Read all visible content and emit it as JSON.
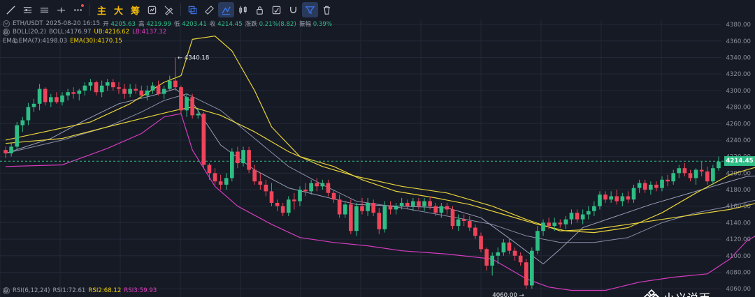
{
  "toolbar": {
    "items": [
      {
        "name": "trend-line-icon"
      },
      {
        "name": "horizontal-lines-icon"
      },
      {
        "name": "parallel-lines-icon"
      },
      {
        "name": "ray-line-icon"
      },
      {
        "name": "more-icon"
      },
      {
        "name": "cjk-main",
        "text": "主"
      },
      {
        "name": "cjk-big",
        "text": "大"
      },
      {
        "name": "cjk-chip",
        "text": "筹"
      },
      {
        "name": "indicator-icon"
      },
      {
        "name": "draw-off-icon"
      },
      {
        "name": "copy-icon"
      },
      {
        "name": "ruler-icon"
      },
      {
        "name": "draw-active-icon"
      },
      {
        "name": "candle-type-icon"
      },
      {
        "name": "lock-icon"
      },
      {
        "name": "screenshot-icon"
      },
      {
        "name": "magnet-icon"
      },
      {
        "name": "filter-icon"
      },
      {
        "name": "trash-icon"
      }
    ]
  },
  "ohlc": {
    "symbol": "ETH/USDT",
    "datetime": "2025-08-20 16:15",
    "open_label": "开",
    "open": "4205.63",
    "high_label": "高",
    "high": "4219.99",
    "low_label": "低",
    "low": "4203.41",
    "close_label": "收",
    "close": "4214.45",
    "change_label": "涨跌",
    "change": "0.21%(8.82)",
    "amp_label": "振幅",
    "amp": "0.39%"
  },
  "boll": {
    "name": "BOLL(20,2)",
    "mid": "BOLL:4176.97",
    "ub": "UB:4216.62",
    "lb": "LB:4137.32"
  },
  "ema": {
    "name": "EMA",
    "ema7": "EMA(7):4198.03",
    "ema30": "EMA(30):4170.15"
  },
  "rsi": {
    "name": "RSI(6,12,24)",
    "rsi1": "RSI1:72.61",
    "rsi2": "RSI2:68.12",
    "rsi3": "RSI3:59.93"
  },
  "annotations": {
    "high": "4340.18",
    "low": "4060.00"
  },
  "price_tag": "4214.45",
  "watermark": "@ 小义说币",
  "colors": {
    "up": "#2ebd85",
    "down": "#f0445a",
    "ub": "#e8d33a",
    "lb": "#d63cc0",
    "mid": "#8a8fa8",
    "ema7": "#9a9fb8",
    "ema30": "#e8d33a",
    "grid": "#232838",
    "axis_text": "#8b8f99"
  },
  "chart_data": {
    "type": "candlestick",
    "yaxis": {
      "ticks": [
        "4380.00",
        "4360.00",
        "4340.00",
        "4320.00",
        "4300.00",
        "4280.00",
        "4260.00",
        "4240.00",
        "4220.00",
        "4200.00",
        "4180.00",
        "4160.00",
        "4140.00",
        "4120.00",
        "4100.00",
        "4080.00",
        "4060.00"
      ],
      "range": [
        4050,
        4386
      ]
    },
    "current_price": 4214.45,
    "candles": [
      [
        4228,
        4232,
        4218,
        4224
      ],
      [
        4224,
        4236,
        4220,
        4232
      ],
      [
        4232,
        4262,
        4228,
        4258
      ],
      [
        4258,
        4268,
        4250,
        4264
      ],
      [
        4264,
        4285,
        4258,
        4280
      ],
      [
        4280,
        4290,
        4274,
        4284
      ],
      [
        4284,
        4308,
        4276,
        4302
      ],
      [
        4302,
        4304,
        4282,
        4286
      ],
      [
        4286,
        4296,
        4280,
        4292
      ],
      [
        4292,
        4298,
        4284,
        4286
      ],
      [
        4286,
        4298,
        4282,
        4294
      ],
      [
        4294,
        4302,
        4288,
        4298
      ],
      [
        4298,
        4304,
        4290,
        4296
      ],
      [
        4296,
        4302,
        4288,
        4300
      ],
      [
        4300,
        4310,
        4294,
        4306
      ],
      [
        4306,
        4314,
        4300,
        4310
      ],
      [
        4310,
        4312,
        4294,
        4298
      ],
      [
        4298,
        4312,
        4292,
        4306
      ],
      [
        4306,
        4314,
        4300,
        4310
      ],
      [
        4310,
        4314,
        4300,
        4304
      ],
      [
        4304,
        4310,
        4296,
        4302
      ],
      [
        4302,
        4308,
        4290,
        4296
      ],
      [
        4296,
        4308,
        4292,
        4302
      ],
      [
        4302,
        4308,
        4296,
        4300
      ],
      [
        4300,
        4306,
        4290,
        4294
      ],
      [
        4294,
        4306,
        4288,
        4300
      ],
      [
        4300,
        4310,
        4296,
        4306
      ],
      [
        4306,
        4312,
        4294,
        4296
      ],
      [
        4296,
        4306,
        4290,
        4302
      ],
      [
        4302,
        4318,
        4300,
        4312
      ],
      [
        4312,
        4340,
        4300,
        4304
      ],
      [
        4304,
        4306,
        4272,
        4276
      ],
      [
        4276,
        4296,
        4268,
        4292
      ],
      [
        4292,
        4296,
        4266,
        4270
      ],
      [
        4270,
        4278,
        4266,
        4272
      ],
      [
        4272,
        4274,
        4206,
        4210
      ],
      [
        4210,
        4212,
        4192,
        4200
      ],
      [
        4200,
        4206,
        4186,
        4190
      ],
      [
        4190,
        4198,
        4180,
        4186
      ],
      [
        4186,
        4200,
        4180,
        4194
      ],
      [
        4194,
        4230,
        4190,
        4226
      ],
      [
        4226,
        4232,
        4206,
        4212
      ],
      [
        4212,
        4232,
        4208,
        4228
      ],
      [
        4228,
        4232,
        4200,
        4204
      ],
      [
        4204,
        4210,
        4186,
        4190
      ],
      [
        4190,
        4200,
        4180,
        4186
      ],
      [
        4186,
        4192,
        4172,
        4178
      ],
      [
        4178,
        4188,
        4160,
        4164
      ],
      [
        4164,
        4168,
        4154,
        4160
      ],
      [
        4160,
        4164,
        4148,
        4152
      ],
      [
        4152,
        4172,
        4148,
        4168
      ],
      [
        4168,
        4176,
        4156,
        4166
      ],
      [
        4166,
        4184,
        4160,
        4180
      ],
      [
        4180,
        4188,
        4172,
        4178
      ],
      [
        4178,
        4192,
        4174,
        4188
      ],
      [
        4188,
        4194,
        4178,
        4184
      ],
      [
        4184,
        4192,
        4180,
        4188
      ],
      [
        4188,
        4192,
        4172,
        4176
      ],
      [
        4176,
        4180,
        4164,
        4168
      ],
      [
        4168,
        4174,
        4146,
        4150
      ],
      [
        4150,
        4166,
        4146,
        4162
      ],
      [
        4162,
        4168,
        4126,
        4130
      ],
      [
        4130,
        4164,
        4124,
        4160
      ],
      [
        4160,
        4170,
        4150,
        4154
      ],
      [
        4154,
        4170,
        4148,
        4164
      ],
      [
        4164,
        4168,
        4148,
        4152
      ],
      [
        4152,
        4158,
        4126,
        4132
      ],
      [
        4132,
        4166,
        4128,
        4160
      ],
      [
        4160,
        4166,
        4150,
        4156
      ],
      [
        4156,
        4164,
        4150,
        4160
      ],
      [
        4160,
        4170,
        4156,
        4164
      ],
      [
        4164,
        4168,
        4156,
        4160
      ],
      [
        4160,
        4170,
        4154,
        4166
      ],
      [
        4166,
        4170,
        4156,
        4160
      ],
      [
        4160,
        4170,
        4154,
        4166
      ],
      [
        4166,
        4172,
        4156,
        4160
      ],
      [
        4160,
        4164,
        4148,
        4152
      ],
      [
        4152,
        4164,
        4146,
        4160
      ],
      [
        4160,
        4164,
        4150,
        4156
      ],
      [
        4156,
        4160,
        4132,
        4136
      ],
      [
        4136,
        4150,
        4130,
        4144
      ],
      [
        4144,
        4150,
        4136,
        4142
      ],
      [
        4142,
        4148,
        4130,
        4134
      ],
      [
        4134,
        4138,
        4120,
        4124
      ],
      [
        4124,
        4128,
        4104,
        4108
      ],
      [
        4108,
        4110,
        4082,
        4088
      ],
      [
        4088,
        4104,
        4076,
        4100
      ],
      [
        4100,
        4110,
        4090,
        4104
      ],
      [
        4104,
        4120,
        4100,
        4116
      ],
      [
        4116,
        4120,
        4102,
        4106
      ],
      [
        4106,
        4110,
        4094,
        4100
      ],
      [
        4100,
        4104,
        4088,
        4092
      ],
      [
        4092,
        4096,
        4060,
        4064
      ],
      [
        4064,
        4110,
        4060,
        4106
      ],
      [
        4106,
        4136,
        4102,
        4130
      ],
      [
        4130,
        4144,
        4124,
        4140
      ],
      [
        4140,
        4146,
        4132,
        4136
      ],
      [
        4136,
        4146,
        4130,
        4140
      ],
      [
        4140,
        4144,
        4134,
        4138
      ],
      [
        4138,
        4148,
        4132,
        4144
      ],
      [
        4144,
        4156,
        4138,
        4152
      ],
      [
        4152,
        4156,
        4140,
        4144
      ],
      [
        4144,
        4156,
        4138,
        4150
      ],
      [
        4150,
        4160,
        4144,
        4154
      ],
      [
        4154,
        4166,
        4148,
        4160
      ],
      [
        4160,
        4178,
        4156,
        4174
      ],
      [
        4174,
        4178,
        4164,
        4168
      ],
      [
        4168,
        4178,
        4164,
        4172
      ],
      [
        4172,
        4180,
        4162,
        4166
      ],
      [
        4166,
        4176,
        4160,
        4172
      ],
      [
        4172,
        4178,
        4164,
        4168
      ],
      [
        4168,
        4186,
        4164,
        4182
      ],
      [
        4182,
        4192,
        4176,
        4188
      ],
      [
        4188,
        4192,
        4176,
        4180
      ],
      [
        4180,
        4190,
        4174,
        4186
      ],
      [
        4186,
        4190,
        4178,
        4182
      ],
      [
        4182,
        4196,
        4178,
        4192
      ],
      [
        4192,
        4198,
        4184,
        4190
      ],
      [
        4190,
        4204,
        4186,
        4200
      ],
      [
        4200,
        4210,
        4194,
        4206
      ],
      [
        4206,
        4212,
        4196,
        4200
      ],
      [
        4200,
        4204,
        4190,
        4194
      ],
      [
        4194,
        4206,
        4186,
        4204
      ],
      [
        4204,
        4214,
        4196,
        4202
      ],
      [
        4202,
        4208,
        4186,
        4190
      ],
      [
        4190,
        4210,
        4186,
        4206
      ],
      [
        4206,
        4220,
        4203,
        4214
      ]
    ],
    "lines": {
      "ub": [
        [
          0,
          4240
        ],
        [
          15,
          4262
        ],
        [
          22,
          4284
        ],
        [
          28,
          4310
        ],
        [
          31,
          4318
        ],
        [
          33,
          4362
        ],
        [
          37,
          4366
        ],
        [
          40,
          4348
        ],
        [
          44,
          4300
        ],
        [
          47,
          4256
        ],
        [
          52,
          4220
        ],
        [
          58,
          4208
        ],
        [
          63,
          4192
        ],
        [
          69,
          4178
        ],
        [
          76,
          4170
        ],
        [
          82,
          4162
        ],
        [
          88,
          4150
        ],
        [
          94,
          4138
        ],
        [
          99,
          4130
        ],
        [
          104,
          4128
        ],
        [
          110,
          4134
        ],
        [
          116,
          4152
        ],
        [
          122,
          4176
        ],
        [
          128,
          4198
        ],
        [
          133,
          4208
        ],
        [
          137,
          4216
        ]
      ],
      "lb": [
        [
          0,
          4208
        ],
        [
          10,
          4210
        ],
        [
          18,
          4230
        ],
        [
          24,
          4248
        ],
        [
          28,
          4268
        ],
        [
          31,
          4272
        ],
        [
          33,
          4228
        ],
        [
          37,
          4184
        ],
        [
          41,
          4160
        ],
        [
          47,
          4138
        ],
        [
          52,
          4122
        ],
        [
          58,
          4116
        ],
        [
          64,
          4112
        ],
        [
          70,
          4106
        ],
        [
          78,
          4102
        ],
        [
          86,
          4096
        ],
        [
          92,
          4072
        ],
        [
          96,
          4062
        ],
        [
          100,
          4058
        ],
        [
          106,
          4058
        ],
        [
          112,
          4068
        ],
        [
          118,
          4074
        ],
        [
          124,
          4078
        ],
        [
          128,
          4096
        ],
        [
          131,
          4118
        ],
        [
          134,
          4130
        ],
        [
          137,
          4137
        ]
      ],
      "mid": [
        [
          0,
          4224
        ],
        [
          10,
          4240
        ],
        [
          18,
          4256
        ],
        [
          24,
          4274
        ],
        [
          28,
          4288
        ],
        [
          32,
          4296
        ],
        [
          38,
          4276
        ],
        [
          44,
          4242
        ],
        [
          50,
          4208
        ],
        [
          56,
          4186
        ],
        [
          62,
          4166
        ],
        [
          70,
          4158
        ],
        [
          78,
          4148
        ],
        [
          86,
          4138
        ],
        [
          92,
          4124
        ],
        [
          98,
          4116
        ],
        [
          104,
          4116
        ],
        [
          110,
          4122
        ],
        [
          116,
          4140
        ],
        [
          122,
          4152
        ],
        [
          128,
          4160
        ],
        [
          133,
          4168
        ],
        [
          137,
          4177
        ]
      ],
      "ema7": [
        [
          0,
          4224
        ],
        [
          8,
          4242
        ],
        [
          14,
          4264
        ],
        [
          20,
          4284
        ],
        [
          26,
          4294
        ],
        [
          30,
          4302
        ],
        [
          33,
          4286
        ],
        [
          38,
          4234
        ],
        [
          44,
          4204
        ],
        [
          50,
          4182
        ],
        [
          56,
          4172
        ],
        [
          62,
          4162
        ],
        [
          70,
          4160
        ],
        [
          78,
          4158
        ],
        [
          84,
          4146
        ],
        [
          90,
          4116
        ],
        [
          95,
          4090
        ],
        [
          98,
          4108
        ],
        [
          102,
          4134
        ],
        [
          108,
          4148
        ],
        [
          114,
          4162
        ],
        [
          120,
          4174
        ],
        [
          126,
          4186
        ],
        [
          131,
          4196
        ],
        [
          137,
          4198
        ]
      ],
      "ema30": [
        [
          0,
          4236
        ],
        [
          10,
          4242
        ],
        [
          18,
          4256
        ],
        [
          24,
          4266
        ],
        [
          30,
          4276
        ],
        [
          33,
          4280
        ],
        [
          38,
          4270
        ],
        [
          44,
          4250
        ],
        [
          50,
          4226
        ],
        [
          56,
          4208
        ],
        [
          62,
          4196
        ],
        [
          70,
          4184
        ],
        [
          78,
          4176
        ],
        [
          86,
          4160
        ],
        [
          92,
          4144
        ],
        [
          98,
          4130
        ],
        [
          104,
          4132
        ],
        [
          110,
          4138
        ],
        [
          116,
          4144
        ],
        [
          122,
          4150
        ],
        [
          128,
          4156
        ],
        [
          133,
          4164
        ],
        [
          137,
          4170
        ]
      ]
    }
  }
}
